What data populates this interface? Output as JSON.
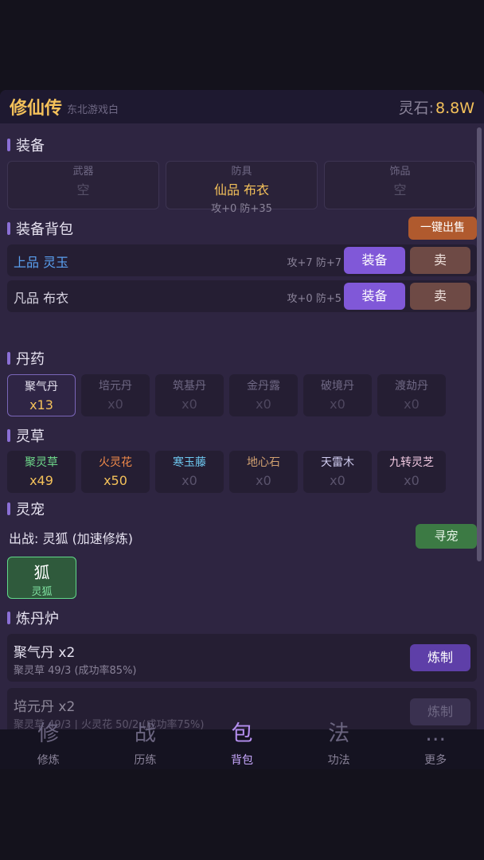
{
  "header": {
    "title": "修仙传",
    "subtitle": "东北游戏白",
    "currency_label": "灵石:",
    "currency_value": "8.8W"
  },
  "equipment": {
    "title": "装备",
    "slots": [
      {
        "label": "武器",
        "value": "空",
        "stats": ""
      },
      {
        "label": "防具",
        "value": "仙品 布衣",
        "stats": "攻+0 防+35"
      },
      {
        "label": "饰品",
        "value": "空",
        "stats": ""
      }
    ]
  },
  "bag": {
    "title": "装备背包",
    "sell_all_label": "一键出售",
    "items": [
      {
        "name": "上品 灵玉",
        "stats": "攻+7 防+7",
        "equip_label": "装备",
        "sell_label": "卖",
        "color": "#5aa0f0"
      },
      {
        "name": "凡品 布衣",
        "stats": "攻+0 防+5",
        "equip_label": "装备",
        "sell_label": "卖",
        "color": "#d8d4e2"
      }
    ]
  },
  "pills": {
    "title": "丹药",
    "items": [
      {
        "name": "聚气丹",
        "count": "x13"
      },
      {
        "name": "培元丹",
        "count": "x0"
      },
      {
        "name": "筑基丹",
        "count": "x0"
      },
      {
        "name": "金丹露",
        "count": "x0"
      },
      {
        "name": "破境丹",
        "count": "x0"
      },
      {
        "name": "渡劫丹",
        "count": "x0"
      }
    ]
  },
  "herbs": {
    "title": "灵草",
    "items": [
      {
        "name": "聚灵草",
        "count": "x49",
        "color": "#6ed88a"
      },
      {
        "name": "火灵花",
        "count": "x50",
        "color": "#f08a4a"
      },
      {
        "name": "寒玉藤",
        "count": "x0",
        "color": "#6ec8f0"
      },
      {
        "name": "地心石",
        "count": "x0",
        "color": "#d0a070"
      },
      {
        "name": "天雷木",
        "count": "x0",
        "color": "#d0ccf0"
      },
      {
        "name": "九转灵芝",
        "count": "x0",
        "color": "#f0c8e0"
      }
    ]
  },
  "pet": {
    "title": "灵宠",
    "active_text": "出战: 灵狐 (加速修炼)",
    "find_label": "寻宠",
    "card_glyph": "狐",
    "card_name": "灵狐"
  },
  "furnace": {
    "title": "炼丹炉",
    "recipes": [
      {
        "name": "聚气丹 x2",
        "desc": "聚灵草 49/3 (成功率85%)",
        "button": "炼制"
      },
      {
        "name": "培元丹 x2",
        "desc": "聚灵草 49/3 | 火灵花 50/2 (成功率75%)",
        "button": "炼制"
      }
    ]
  },
  "nav": [
    {
      "glyph": "修",
      "label": "修炼"
    },
    {
      "glyph": "战",
      "label": "历练"
    },
    {
      "glyph": "包",
      "label": "背包"
    },
    {
      "glyph": "法",
      "label": "功法"
    },
    {
      "glyph": "...",
      "label": "更多"
    }
  ]
}
